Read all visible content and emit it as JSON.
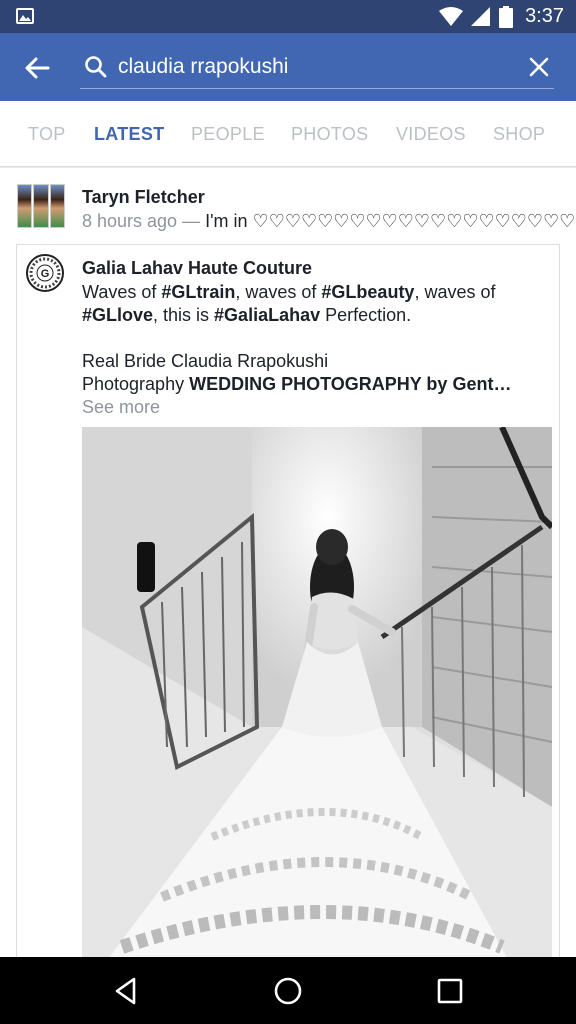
{
  "status_bar": {
    "time": "3:37",
    "icons": [
      "gallery-icon",
      "wifi-icon",
      "cell-signal-icon",
      "battery-icon"
    ]
  },
  "search": {
    "query": "claudia rrapokushi"
  },
  "tabs": [
    {
      "label": "TOP",
      "active": false
    },
    {
      "label": "LATEST",
      "active": true
    },
    {
      "label": "PEOPLE",
      "active": false
    },
    {
      "label": "PHOTOS",
      "active": false
    },
    {
      "label": "VIDEOS",
      "active": false
    },
    {
      "label": "SHOP",
      "active": false
    }
  ],
  "story": {
    "author": "Taryn Fletcher",
    "time": "8 hours ago",
    "separator": "—",
    "activity": "I'm in ♡♡♡♡♡♡♡♡♡♡♡♡♡♡♡♡♡♡♡♡"
  },
  "shared_post": {
    "page_name": "Galia Lahav Haute Couture",
    "logo_letter": "G",
    "line1": {
      "t1": "Waves of ",
      "tag1": "#GLtrain",
      "t2": ", waves of ",
      "tag2": "#GLbeauty",
      "t3": ", waves of"
    },
    "line2": {
      "tag3": "#GLlove",
      "t4": ", this is ",
      "tag4": "#GaliaLahav",
      "t5": " Perfection."
    },
    "line3": "Real Bride Claudia Rrapokushi",
    "line4": {
      "t6": "Photography ",
      "bold": "WEDDING PHOTOGRAPHY by Gent…"
    },
    "see_more": "See more"
  },
  "colors": {
    "status_bar": "#2f4472",
    "header": "#4267b2",
    "accent": "#4267b2",
    "muted": "#90949c"
  }
}
